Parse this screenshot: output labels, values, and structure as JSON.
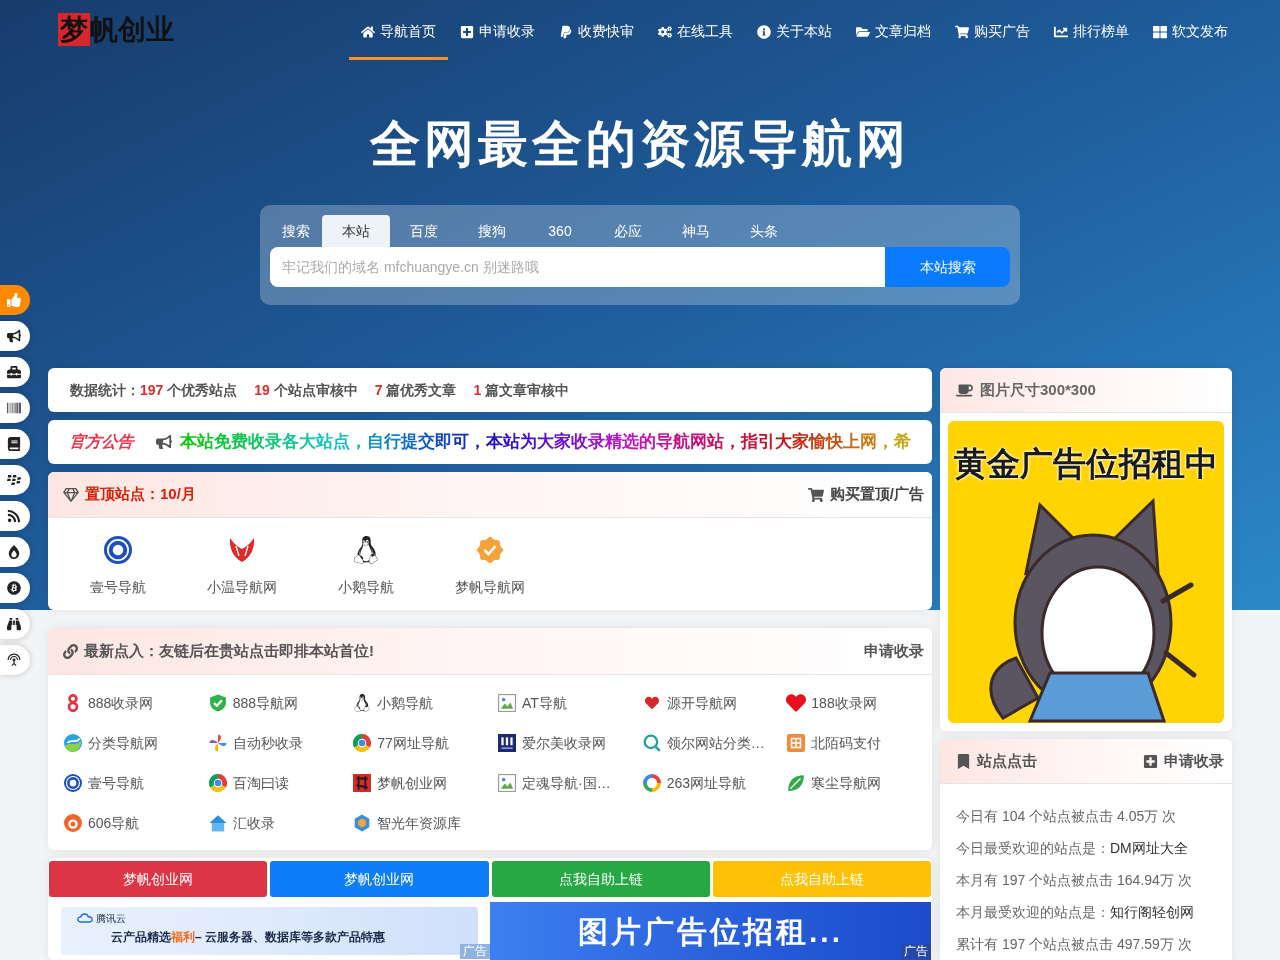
{
  "logo": "梦帆创业",
  "nav": [
    {
      "label": "导航首页",
      "selected": true
    },
    {
      "label": "申请收录",
      "selected": false
    },
    {
      "label": "收费快审",
      "selected": false
    },
    {
      "label": "在线工具",
      "selected": false
    },
    {
      "label": "关于本站",
      "selected": false
    },
    {
      "label": "文章归档",
      "selected": false
    },
    {
      "label": "购买广告",
      "selected": false
    },
    {
      "label": "排行榜单",
      "selected": false
    },
    {
      "label": "软文发布",
      "selected": false
    }
  ],
  "hero": {
    "title": "全网最全的资源导航网"
  },
  "search": {
    "label": "搜索",
    "tabs": [
      {
        "label": "本站",
        "selected": true
      },
      {
        "label": "百度",
        "selected": false
      },
      {
        "label": "搜狗",
        "selected": false
      },
      {
        "label": "360",
        "selected": false
      },
      {
        "label": "必应",
        "selected": false
      },
      {
        "label": "神马",
        "selected": false
      },
      {
        "label": "头条",
        "selected": false
      }
    ],
    "placeholder": "牢记我们的域名 mfchuangye.cn 别迷路哦",
    "button": "本站搜索"
  },
  "side_toolbar": [
    {
      "selected": true
    },
    {
      "selected": false
    },
    {
      "selected": false
    },
    {
      "selected": false
    },
    {
      "selected": false
    },
    {
      "selected": false
    },
    {
      "selected": false
    },
    {
      "selected": false
    },
    {
      "selected": false
    },
    {
      "selected": false
    },
    {
      "selected": false
    }
  ],
  "stats": {
    "label": "数据统计：",
    "items": [
      {
        "value": "197",
        "text": "个优秀站点"
      },
      {
        "value": "19",
        "text": "个站点审核中"
      },
      {
        "value": "7",
        "text": "篇优秀文章"
      },
      {
        "value": "1",
        "text": "篇文章审核中"
      }
    ]
  },
  "announcement": {
    "badge": "官方公告",
    "text": "本站免费收录各大站点，自行提交即可，本站为大家收录精选的导航网站，指引大家愉快上网，希"
  },
  "top_sites": {
    "title": "置顶站点：10/月",
    "action": "购买置顶/广告",
    "items": [
      "壹号导航",
      "小温导航网",
      "小鹅导航",
      "梦帆导航网"
    ]
  },
  "latest_sites": {
    "title": "最新点入：友链后在贵站点击即排本站首位!",
    "action": "申请收录",
    "items": [
      "888收录网",
      "888导航网",
      "小鹅导航",
      "AT导航",
      "源开导航网",
      "188收录网",
      "分类导航网",
      "自动秒收录",
      "77网址导航",
      "爱尔美收录网",
      "领尔网站分类…",
      "北陌码支付",
      "壹号导航",
      "百淘曰读",
      "梦帆创业网",
      "定魂导航·国…",
      "263网址导航",
      "寒尘导航网",
      "606导航",
      "汇收录",
      "智光年资源库"
    ]
  },
  "link_buttons": [
    {
      "label": "梦帆创业网",
      "color": "#dc3545"
    },
    {
      "label": "梦帆创业网",
      "color": "#0d7ef7"
    },
    {
      "label": "点我自助上链",
      "color": "#28a745"
    },
    {
      "label": "点我自助上链",
      "color": "#ffc107"
    }
  ],
  "ads": [
    {
      "kind": "text_banner",
      "brand": "腾讯云",
      "parts": [
        {
          "text": "云产品精选",
          "highlight": false
        },
        {
          "text": "福利",
          "highlight": true
        },
        {
          "text": "– 云服务器、数据库等多款产品特惠",
          "highlight": false
        }
      ],
      "tag": "广告"
    },
    {
      "kind": "image_banner",
      "text": "图片广告位招租...",
      "tag": "广告"
    }
  ],
  "side_ad": {
    "title": "图片尺寸300*300",
    "headline": "黄金广告位招租中"
  },
  "site_clicks": {
    "title": "站点点击",
    "action": "申请收录",
    "lines": [
      {
        "text": "今日有 104 个站点被点击 4.05万 次"
      },
      {
        "text": "今日最受欢迎的站点是：",
        "link": "DM网址大全"
      },
      {
        "text": "本月有 197 个站点被点击 164.94万 次"
      },
      {
        "text": "本月最受欢迎的站点是：",
        "link": "知行阁轻创网"
      },
      {
        "text": "累计有 197 个站点被点击 497.59万 次"
      }
    ]
  }
}
